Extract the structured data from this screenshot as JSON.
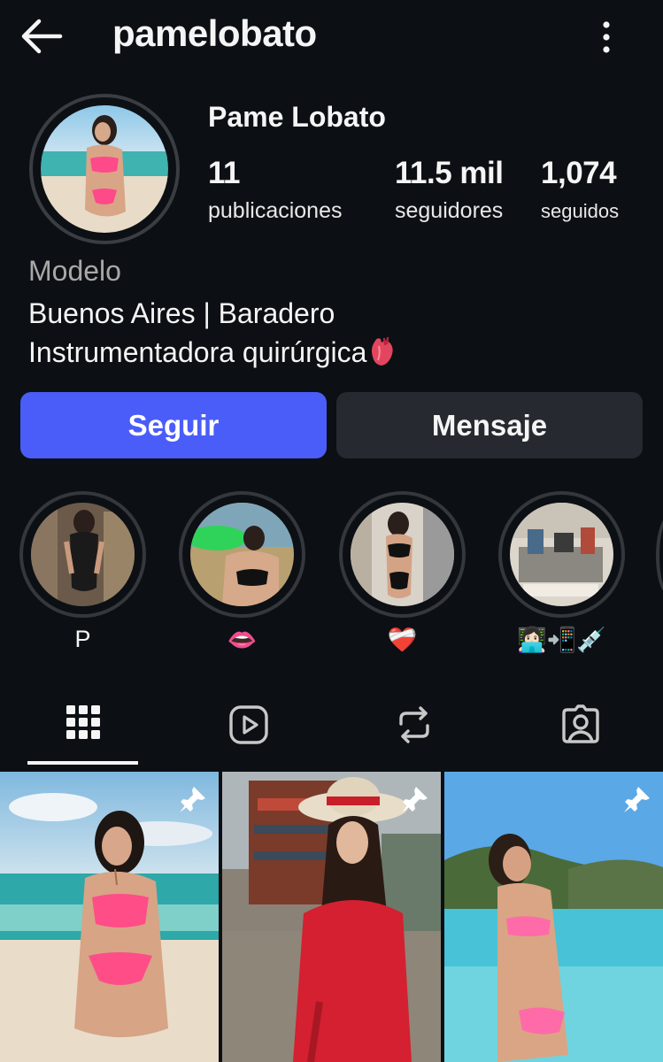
{
  "header": {
    "username": "pamelobato",
    "back_icon": "arrow-left-icon",
    "more_icon": "kebab-vertical-icon"
  },
  "profile": {
    "full_name": "Pame Lobato",
    "stats": {
      "posts_value": "11",
      "posts_label": "publicaciones",
      "followers_value": "11.5 mil",
      "followers_label": "seguidores",
      "following_value": "1,074",
      "following_label": "seguidos"
    },
    "category": "Modelo",
    "bio_line_1": "Buenos Aires | Baradero",
    "bio_line_2": "Instrumentadora quirúrgica"
  },
  "actions": {
    "follow_label": "Seguir",
    "message_label": "Mensaje"
  },
  "highlights": [
    {
      "label": "P"
    },
    {
      "label": "👄"
    },
    {
      "label": "❤️‍🩹"
    },
    {
      "label": "👩🏻‍💻📲💉"
    }
  ],
  "tabs": [
    {
      "icon": "grid-icon"
    },
    {
      "icon": "reels-icon"
    },
    {
      "icon": "reposts-icon"
    },
    {
      "icon": "tagged-icon"
    }
  ],
  "colors": {
    "background": "#0c1014",
    "primary_button": "#4a5df9",
    "secondary_button": "#262a30",
    "muted_text": "#a8a8a8"
  }
}
